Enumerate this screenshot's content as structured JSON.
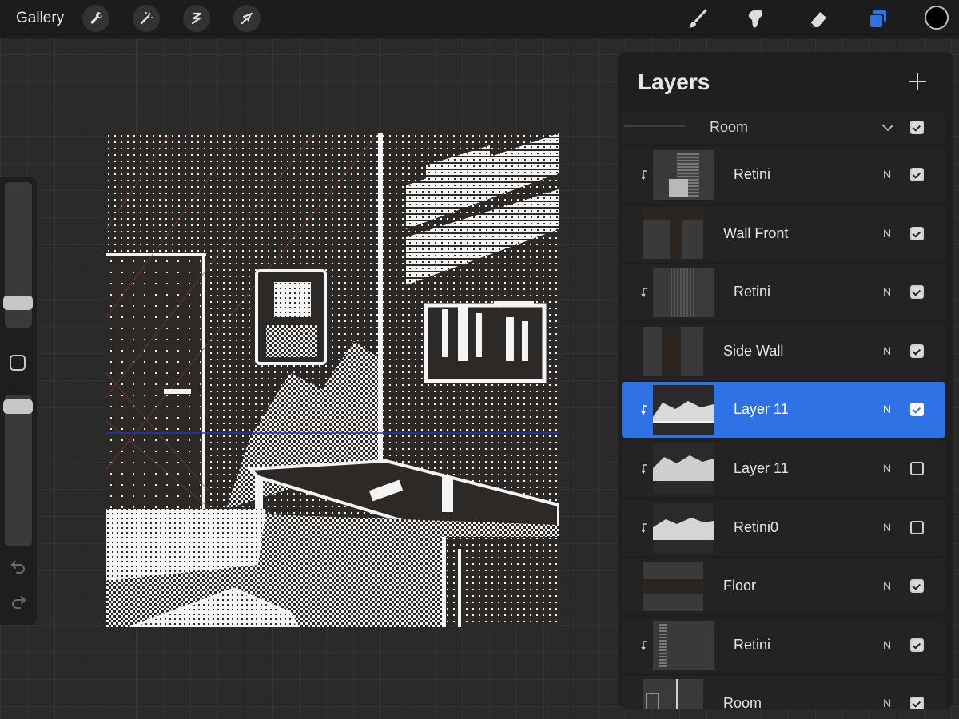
{
  "topbar": {
    "gallery_label": "Gallery",
    "tools": [
      {
        "name": "wrench-icon"
      },
      {
        "name": "magic-wand-icon"
      },
      {
        "name": "selection-icon"
      },
      {
        "name": "transform-arrow-icon"
      }
    ],
    "right_tools": [
      {
        "name": "brush-icon"
      },
      {
        "name": "smudge-icon"
      },
      {
        "name": "eraser-icon"
      },
      {
        "name": "layers-icon",
        "color": "#2f72e6"
      }
    ],
    "current_color": "#000000"
  },
  "layers_panel": {
    "title": "Layers",
    "group": {
      "name": "Room",
      "visible": true
    },
    "layers": [
      {
        "name": "Retini",
        "blend": "N",
        "visible": true,
        "clipped": true,
        "selected": false
      },
      {
        "name": "Wall Front",
        "blend": "N",
        "visible": true,
        "clipped": false,
        "selected": false
      },
      {
        "name": "Retini",
        "blend": "N",
        "visible": true,
        "clipped": true,
        "selected": false
      },
      {
        "name": "Side Wall",
        "blend": "N",
        "visible": true,
        "clipped": false,
        "selected": false
      },
      {
        "name": "Layer 11",
        "blend": "N",
        "visible": true,
        "clipped": true,
        "selected": true
      },
      {
        "name": "Layer 11",
        "blend": "N",
        "visible": false,
        "clipped": true,
        "selected": false
      },
      {
        "name": "Retini0",
        "blend": "N",
        "visible": false,
        "clipped": true,
        "selected": false
      },
      {
        "name": "Floor",
        "blend": "N",
        "visible": true,
        "clipped": false,
        "selected": false
      },
      {
        "name": "Retini",
        "blend": "N",
        "visible": true,
        "clipped": true,
        "selected": false
      },
      {
        "name": "Room",
        "blend": "N",
        "visible": true,
        "clipped": false,
        "selected": false
      }
    ]
  }
}
